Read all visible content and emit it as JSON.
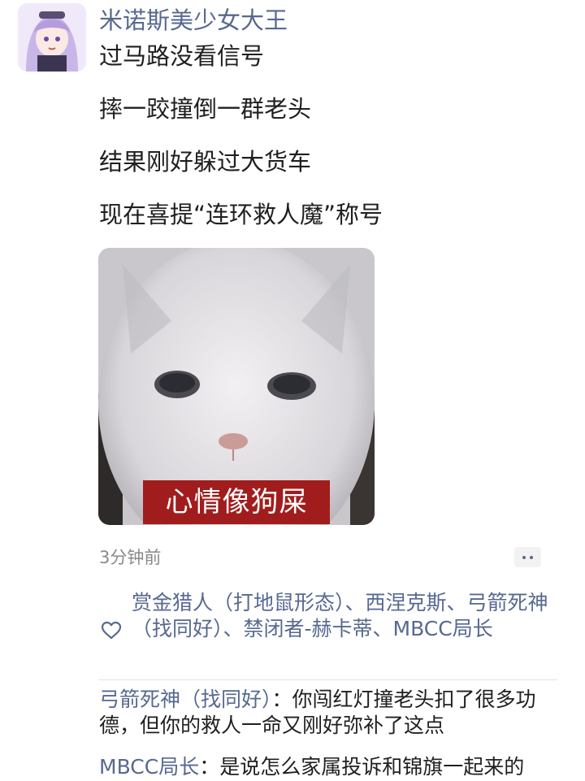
{
  "post": {
    "author": "米诺斯美少女大王",
    "lines": [
      "过马路没看信号",
      "摔一跤撞倒一群老头",
      "结果刚好躲过大货车",
      "现在喜提“连环救人魔”称号"
    ],
    "image_caption": "心情像狗屎",
    "time": "3分钟前"
  },
  "likes": {
    "icon": "heart-outline-icon",
    "names": "赏金猎人（打地鼠形态）、西涅克斯、弓箭死神（找同好）、禁闭者-赫卡蒂、MBCC局长"
  },
  "comments": [
    {
      "name": "弓箭死神（找同好）",
      "text": "你闯红灯撞老头扣了很多功德，但你的救人一命又刚好弥补了这点"
    },
    {
      "name": "MBCC局长",
      "text": "是说怎么家属投诉和锦旗一起来的"
    }
  ],
  "colors": {
    "link": "#57698f",
    "caption_bg": "#a11d1d"
  }
}
